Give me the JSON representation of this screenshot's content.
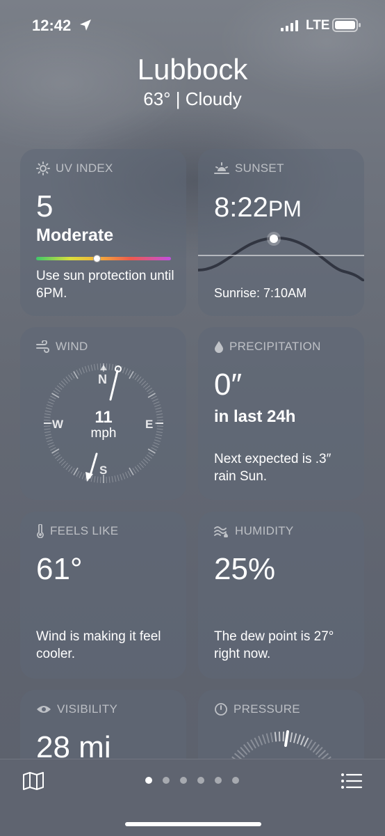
{
  "status": {
    "time": "12:42",
    "network": "LTE"
  },
  "header": {
    "city": "Lubbock",
    "temp_cond": "63°  |  Cloudy"
  },
  "uv": {
    "title": "UV INDEX",
    "value": "5",
    "level": "Moderate",
    "desc": "Use sun protection until 6PM.",
    "marker_fraction": 0.45
  },
  "sunset": {
    "title": "SUNSET",
    "time_main": "8:22",
    "time_suffix": "PM",
    "sunrise": "Sunrise: 7:10AM"
  },
  "wind": {
    "title": "WIND",
    "speed": "11",
    "unit": "mph",
    "n": "N",
    "e": "E",
    "s": "S",
    "w": "W"
  },
  "precipitation": {
    "title": "PRECIPITATION",
    "amount": "0″",
    "period": "in last 24h",
    "desc": "Next expected is .3″ rain Sun."
  },
  "feels_like": {
    "title": "FEELS LIKE",
    "value": "61°",
    "desc": "Wind is making it feel cooler."
  },
  "humidity": {
    "title": "HUMIDITY",
    "value": "25%",
    "desc": "The dew point is 27° right now."
  },
  "visibility": {
    "title": "VISIBILITY",
    "value": "28 mi"
  },
  "pressure": {
    "title": "PRESSURE"
  },
  "pager": {
    "count": 6,
    "active": 0
  },
  "colors": {
    "card": "#5f6776",
    "uv_gradient": [
      "#3fc86a",
      "#d8e03c",
      "#f4b33a",
      "#ee5a4c",
      "#c24fe0"
    ]
  },
  "icons": [
    "location-arrow-icon",
    "signal-icon",
    "battery-icon",
    "sun-icon",
    "sunset-icon",
    "wind-icon",
    "drop-icon",
    "thermometer-icon",
    "humidity-icon",
    "eye-icon",
    "gauge-icon",
    "map-icon",
    "list-icon"
  ]
}
